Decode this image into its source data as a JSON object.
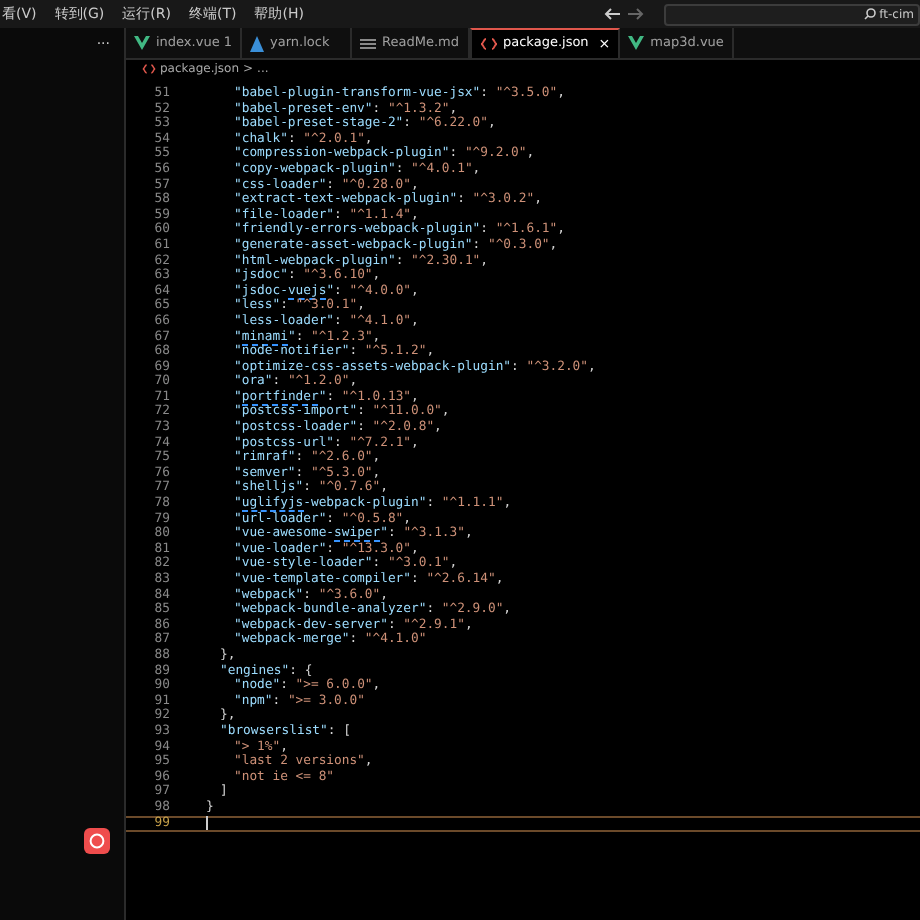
{
  "menu": [
    "看(V)",
    "转到(G)",
    "运行(R)",
    "终端(T)",
    "帮助(H)"
  ],
  "search": {
    "value": "ft-cim"
  },
  "sidebar": {
    "more": "···"
  },
  "tabs": [
    {
      "label": "index.vue 1",
      "kind": "vue",
      "selected": false
    },
    {
      "label": "yarn.lock",
      "kind": "yarn",
      "selected": false
    },
    {
      "label": "ReadMe.md",
      "kind": "md",
      "selected": false
    },
    {
      "label": "package.json",
      "kind": "json",
      "selected": true,
      "close": "×"
    },
    {
      "label": "map3d.vue",
      "kind": "vue",
      "selected": false
    }
  ],
  "breadcrumb": {
    "file": "package.json",
    "sep": ">",
    "rest": "..."
  },
  "lines": [
    {
      "num": "51",
      "kind": "inner",
      "current": false,
      "key": [
        {
          "t": "\"babel-plugin-transform-vue-jsx\"",
          "flagged": false
        }
      ],
      "sep": ": ",
      "value": "\"^3.5.0\"",
      "tail": ","
    },
    {
      "num": "52",
      "kind": "inner",
      "current": false,
      "key": [
        {
          "t": "\"babel-preset-env\"",
          "flagged": false
        }
      ],
      "sep": ": ",
      "value": "\"^1.3.2\"",
      "tail": ","
    },
    {
      "num": "53",
      "kind": "inner",
      "current": false,
      "key": [
        {
          "t": "\"babel-preset-stage-2\"",
          "flagged": false
        }
      ],
      "sep": ": ",
      "value": "\"^6.22.0\"",
      "tail": ","
    },
    {
      "num": "54",
      "kind": "inner",
      "current": false,
      "key": [
        {
          "t": "\"chalk\"",
          "flagged": false
        }
      ],
      "sep": ": ",
      "value": "\"^2.0.1\"",
      "tail": ","
    },
    {
      "num": "55",
      "kind": "inner",
      "current": false,
      "key": [
        {
          "t": "\"compression-webpack-plugin\"",
          "flagged": false
        }
      ],
      "sep": ": ",
      "value": "\"^9.2.0\"",
      "tail": ","
    },
    {
      "num": "56",
      "kind": "inner",
      "current": false,
      "key": [
        {
          "t": "\"copy-webpack-plugin\"",
          "flagged": false
        }
      ],
      "sep": ": ",
      "value": "\"^4.0.1\"",
      "tail": ","
    },
    {
      "num": "57",
      "kind": "inner",
      "current": false,
      "key": [
        {
          "t": "\"css-loader\"",
          "flagged": false
        }
      ],
      "sep": ": ",
      "value": "\"^0.28.0\"",
      "tail": ","
    },
    {
      "num": "58",
      "kind": "inner",
      "current": false,
      "key": [
        {
          "t": "\"extract-text-webpack-plugin\"",
          "flagged": false
        }
      ],
      "sep": ": ",
      "value": "\"^3.0.2\"",
      "tail": ","
    },
    {
      "num": "59",
      "kind": "inner",
      "current": false,
      "key": [
        {
          "t": "\"file-loader\"",
          "flagged": false
        }
      ],
      "sep": ": ",
      "value": "\"^1.1.4\"",
      "tail": ","
    },
    {
      "num": "60",
      "kind": "inner",
      "current": false,
      "key": [
        {
          "t": "\"friendly-errors-webpack-plugin\"",
          "flagged": false
        }
      ],
      "sep": ": ",
      "value": "\"^1.6.1\"",
      "tail": ","
    },
    {
      "num": "61",
      "kind": "inner",
      "current": false,
      "key": [
        {
          "t": "\"generate-asset-webpack-plugin\"",
          "flagged": false
        }
      ],
      "sep": ": ",
      "value": "\"^0.3.0\"",
      "tail": ","
    },
    {
      "num": "62",
      "kind": "inner",
      "current": false,
      "key": [
        {
          "t": "\"html-webpack-plugin\"",
          "flagged": false
        }
      ],
      "sep": ": ",
      "value": "\"^2.30.1\"",
      "tail": ","
    },
    {
      "num": "63",
      "kind": "inner",
      "current": false,
      "key": [
        {
          "t": "\"jsdoc\"",
          "flagged": false
        }
      ],
      "sep": ": ",
      "value": "\"^3.6.10\"",
      "tail": ","
    },
    {
      "num": "64",
      "kind": "inner",
      "current": false,
      "key": [
        {
          "t": "\"jsdoc-",
          "flagged": false
        },
        {
          "t": "vuejs",
          "flagged": true
        },
        {
          "t": "\"",
          "flagged": false
        }
      ],
      "sep": ": ",
      "value": "\"^4.0.0\"",
      "tail": ","
    },
    {
      "num": "65",
      "kind": "inner",
      "current": false,
      "key": [
        {
          "t": "\"less\"",
          "flagged": false
        }
      ],
      "sep": ": ",
      "value": "\"^3.0.1\"",
      "tail": ","
    },
    {
      "num": "66",
      "kind": "inner",
      "current": false,
      "key": [
        {
          "t": "\"less-loader\"",
          "flagged": false
        }
      ],
      "sep": ": ",
      "value": "\"^4.1.0\"",
      "tail": ","
    },
    {
      "num": "67",
      "kind": "inner",
      "current": false,
      "key": [
        {
          "t": "\"",
          "flagged": false
        },
        {
          "t": "minami",
          "flagged": true
        },
        {
          "t": "\"",
          "flagged": false
        }
      ],
      "sep": ": ",
      "value": "\"^1.2.3\"",
      "tail": ","
    },
    {
      "num": "68",
      "kind": "inner",
      "current": false,
      "key": [
        {
          "t": "\"node-notifier\"",
          "flagged": false
        }
      ],
      "sep": ": ",
      "value": "\"^5.1.2\"",
      "tail": ","
    },
    {
      "num": "69",
      "kind": "inner",
      "current": false,
      "key": [
        {
          "t": "\"optimize-css-assets-webpack-plugin\"",
          "flagged": false
        }
      ],
      "sep": ": ",
      "value": "\"^3.2.0\"",
      "tail": ","
    },
    {
      "num": "70",
      "kind": "inner",
      "current": false,
      "key": [
        {
          "t": "\"ora\"",
          "flagged": false
        }
      ],
      "sep": ": ",
      "value": "\"^1.2.0\"",
      "tail": ","
    },
    {
      "num": "71",
      "kind": "inner",
      "current": false,
      "key": [
        {
          "t": "\"",
          "flagged": false
        },
        {
          "t": "portfinder",
          "flagged": true
        },
        {
          "t": "\"",
          "flagged": false
        }
      ],
      "sep": ": ",
      "value": "\"^1.0.13\"",
      "tail": ","
    },
    {
      "num": "72",
      "kind": "inner",
      "current": false,
      "key": [
        {
          "t": "\"postcss-import\"",
          "flagged": false
        }
      ],
      "sep": ": ",
      "value": "\"^11.0.0\"",
      "tail": ","
    },
    {
      "num": "73",
      "kind": "inner",
      "current": false,
      "key": [
        {
          "t": "\"postcss-loader\"",
          "flagged": false
        }
      ],
      "sep": ": ",
      "value": "\"^2.0.8\"",
      "tail": ","
    },
    {
      "num": "74",
      "kind": "inner",
      "current": false,
      "key": [
        {
          "t": "\"postcss-url\"",
          "flagged": false
        }
      ],
      "sep": ": ",
      "value": "\"^7.2.1\"",
      "tail": ","
    },
    {
      "num": "75",
      "kind": "inner",
      "current": false,
      "key": [
        {
          "t": "\"rimraf\"",
          "flagged": false
        }
      ],
      "sep": ": ",
      "value": "\"^2.6.0\"",
      "tail": ","
    },
    {
      "num": "76",
      "kind": "inner",
      "current": false,
      "key": [
        {
          "t": "\"semver\"",
          "flagged": false
        }
      ],
      "sep": ": ",
      "value": "\"^5.3.0\"",
      "tail": ","
    },
    {
      "num": "77",
      "kind": "inner",
      "current": false,
      "key": [
        {
          "t": "\"shelljs\"",
          "flagged": false
        }
      ],
      "sep": ": ",
      "value": "\"^0.7.6\"",
      "tail": ","
    },
    {
      "num": "78",
      "kind": "inner",
      "current": false,
      "key": [
        {
          "t": "\"",
          "flagged": false
        },
        {
          "t": "uglifyjs",
          "flagged": true
        },
        {
          "t": "-webpack-plugin\"",
          "flagged": false
        }
      ],
      "sep": ": ",
      "value": "\"^1.1.1\"",
      "tail": ","
    },
    {
      "num": "79",
      "kind": "inner",
      "current": false,
      "key": [
        {
          "t": "\"url-loader\"",
          "flagged": false
        }
      ],
      "sep": ": ",
      "value": "\"^0.5.8\"",
      "tail": ","
    },
    {
      "num": "80",
      "kind": "inner",
      "current": false,
      "key": [
        {
          "t": "\"vue-awesome-",
          "flagged": false
        },
        {
          "t": "swiper",
          "flagged": true
        },
        {
          "t": "\"",
          "flagged": false
        }
      ],
      "sep": ": ",
      "value": "\"^3.1.3\"",
      "tail": ","
    },
    {
      "num": "81",
      "kind": "inner",
      "current": false,
      "key": [
        {
          "t": "\"vue-loader\"",
          "flagged": false
        }
      ],
      "sep": ": ",
      "value": "\"^13.3.0\"",
      "tail": ","
    },
    {
      "num": "82",
      "kind": "inner",
      "current": false,
      "key": [
        {
          "t": "\"vue-style-loader\"",
          "flagged": false
        }
      ],
      "sep": ": ",
      "value": "\"^3.0.1\"",
      "tail": ","
    },
    {
      "num": "83",
      "kind": "inner",
      "current": false,
      "key": [
        {
          "t": "\"vue-template-compiler\"",
          "flagged": false
        }
      ],
      "sep": ": ",
      "value": "\"^2.6.14\"",
      "tail": ","
    },
    {
      "num": "84",
      "kind": "inner",
      "current": false,
      "key": [
        {
          "t": "\"webpack\"",
          "flagged": false
        }
      ],
      "sep": ": ",
      "value": "\"^3.6.0\"",
      "tail": ","
    },
    {
      "num": "85",
      "kind": "inner",
      "current": false,
      "key": [
        {
          "t": "\"webpack-bundle-analyzer\"",
          "flagged": false
        }
      ],
      "sep": ": ",
      "value": "\"^2.9.0\"",
      "tail": ","
    },
    {
      "num": "86",
      "kind": "inner",
      "current": false,
      "key": [
        {
          "t": "\"webpack-dev-server\"",
          "flagged": false
        }
      ],
      "sep": ": ",
      "value": "\"^2.9.1\"",
      "tail": ","
    },
    {
      "num": "87",
      "kind": "inner",
      "current": false,
      "key": [
        {
          "t": "\"webpack-merge\"",
          "flagged": false
        }
      ],
      "sep": ": ",
      "value": "\"^4.1.0\""
    },
    {
      "num": "88",
      "kind": "mid",
      "current": false,
      "tail": "},"
    },
    {
      "num": "89",
      "kind": "mid",
      "current": false,
      "key": [
        {
          "t": "\"engines\"",
          "flagged": false
        }
      ],
      "sep": ": ",
      "tail": "{"
    },
    {
      "num": "90",
      "kind": "inner",
      "current": false,
      "key": [
        {
          "t": "\"node\"",
          "flagged": false
        }
      ],
      "sep": ": ",
      "value": "\">= 6.0.0\"",
      "tail": ","
    },
    {
      "num": "91",
      "kind": "inner",
      "current": false,
      "key": [
        {
          "t": "\"npm\"",
          "flagged": false
        }
      ],
      "sep": ": ",
      "value": "\">= 3.0.0\""
    },
    {
      "num": "92",
      "kind": "mid",
      "current": false,
      "tail": "},"
    },
    {
      "num": "93",
      "kind": "mid",
      "current": false,
      "key": [
        {
          "t": "\"browserslist\"",
          "flagged": false
        }
      ],
      "sep": ": ",
      "tail": "["
    },
    {
      "num": "94",
      "kind": "inner",
      "current": false,
      "value": "\"> 1%\"",
      "tail": ","
    },
    {
      "num": "95",
      "kind": "inner",
      "current": false,
      "value": "\"last 2 versions\"",
      "tail": ","
    },
    {
      "num": "96",
      "kind": "inner",
      "current": false,
      "value": "\"not ie <= 8\""
    },
    {
      "num": "97",
      "kind": "mid",
      "current": false,
      "tail": "]"
    },
    {
      "num": "98",
      "kind": "root",
      "current": false,
      "tail": "}"
    },
    {
      "num": "99",
      "kind": "root",
      "current": true
    }
  ]
}
